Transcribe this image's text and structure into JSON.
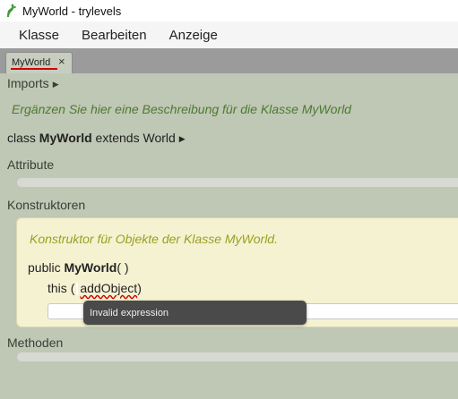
{
  "window": {
    "title": "MyWorld - trylevels",
    "icon": "greenfoot-icon"
  },
  "menu": {
    "items": [
      "Klasse",
      "Bearbeiten",
      "Anzeige"
    ]
  },
  "tabs": [
    {
      "label": "MyWorld",
      "close": "×"
    }
  ],
  "editor": {
    "imports_label": "Imports",
    "class_comment": "Ergänzen Sie hier eine Beschreibung für die Klasse MyWorld",
    "class_decl": {
      "keyword": "class",
      "name": "MyWorld",
      "extends_keyword": "extends",
      "superclass": "World"
    },
    "attributes_label": "Attribute",
    "constructors_label": "Konstruktoren",
    "constructor": {
      "comment": "Konstruktor für Objekte der Klasse MyWorld.",
      "modifier": "public",
      "name": "MyWorld",
      "params": "( )",
      "statement_keyword": "this",
      "statement_open": "(",
      "statement_expr": "addObject",
      "statement_close": ")"
    },
    "methods_label": "Methoden"
  },
  "tooltip": {
    "text": "Invalid expression"
  },
  "colors": {
    "background": "#bfc7b5",
    "comment_green": "#4d7a2f",
    "comment_olive": "#9a9f21",
    "error_red": "#d00000",
    "constructor_bg": "#f5f2d2"
  }
}
